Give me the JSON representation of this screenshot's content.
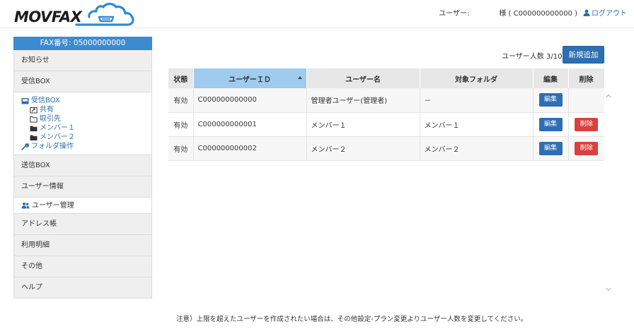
{
  "header": {
    "logo_text": "MOVFAX",
    "user_label": "ユーザー:",
    "user_name": "様 ( C000000000000 )",
    "logout_label": "ログアウト"
  },
  "sidebar": {
    "fax_number": "FAX番号: 05000000000",
    "notice": "お知らせ",
    "inbox": "受信BOX",
    "inbox_tree": {
      "root": "受信BOX",
      "shared": "共有",
      "clients": "取引先",
      "member1": "メンバー１",
      "member2": "メンバー２",
      "folder_ops": "フォルダ操作"
    },
    "outbox": "送信BOX",
    "user_info": "ユーザー情報",
    "user_mgmt": "ユーザー管理",
    "address_book": "アドレス帳",
    "usage": "利用明細",
    "other": "その他",
    "help": "ヘルプ"
  },
  "main": {
    "user_count": "ユーザー人数 3/10",
    "new_button": "新規追加",
    "columns": [
      "状態",
      "ユーザーＩＤ",
      "ユーザー名",
      "対象フォルダ",
      "編集",
      "削除"
    ],
    "rows": [
      {
        "status": "有効",
        "id": "C000000000000",
        "name": "管理者ユーザー(管理者)",
        "folder": "－",
        "edit": "編集",
        "delete": ""
      },
      {
        "status": "有効",
        "id": "C000000000001",
        "name": "メンバー１",
        "folder": "メンバー１",
        "edit": "編集",
        "delete": "削除"
      },
      {
        "status": "有効",
        "id": "C000000000002",
        "name": "メンバー２",
        "folder": "メンバー２",
        "edit": "編集",
        "delete": "削除"
      }
    ],
    "note": "注意）上限を超えたユーザーを作成されたい場合は、その他設定-プラン変更よりユーザー人数を変更してください。"
  },
  "colors": {
    "accent": "#2d6fb2",
    "fax_banner": "#3c8ad0",
    "sorted_header": "#9ecbee",
    "delete": "#d9403e",
    "logo_cloud": "#2f8ad8"
  }
}
